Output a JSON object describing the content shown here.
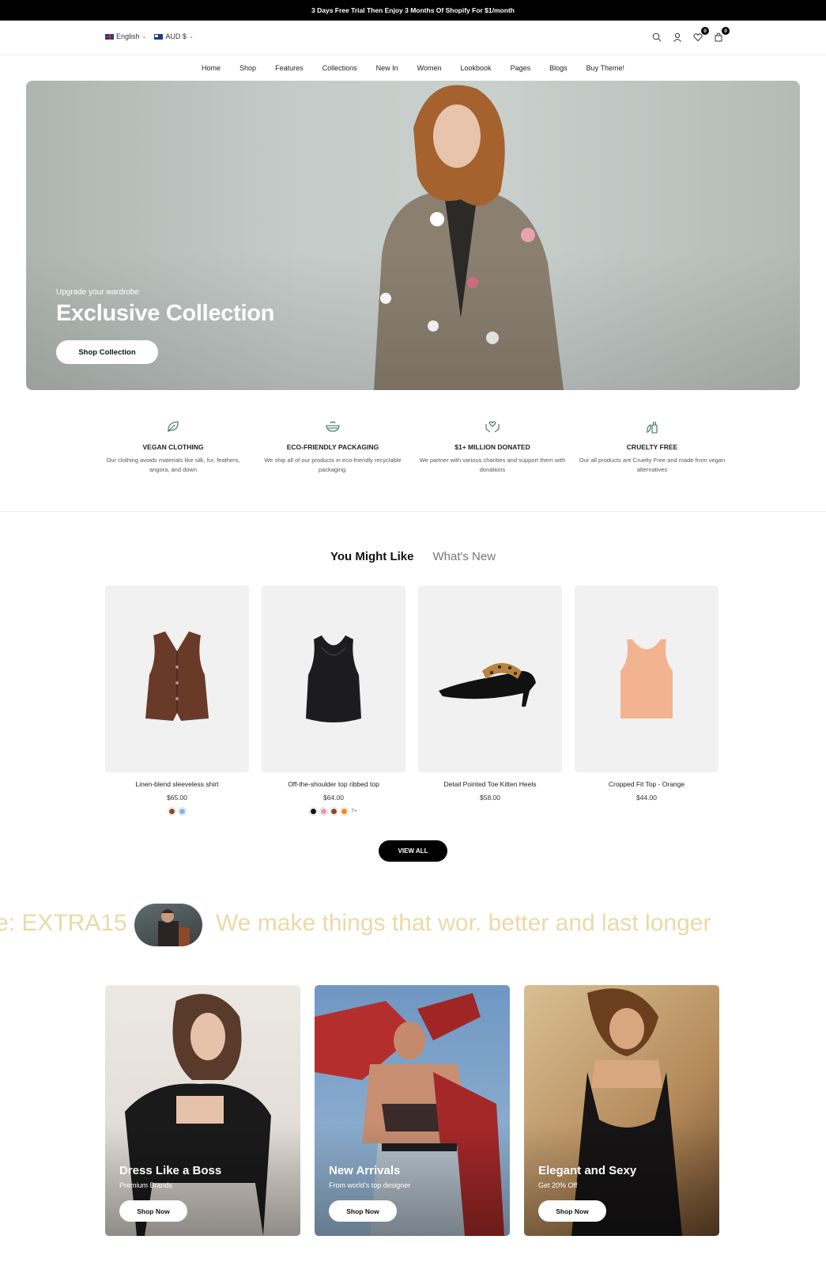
{
  "announcement": "3 Days Free Trial Then Enjoy 3 Months Of Shopify For $1/month",
  "header": {
    "language": "English",
    "currency": "AUD $",
    "wishlist_count": "0",
    "cart_count": "0"
  },
  "nav": [
    "Home",
    "Shop",
    "Features",
    "Collections",
    "New In",
    "Women",
    "Lookbook",
    "Pages",
    "Blogs",
    "Buy Theme!"
  ],
  "hero": {
    "subtitle": "Upgrade your wardrobe",
    "title": "Exclusive Collection",
    "button": "Shop Collection"
  },
  "features": [
    {
      "icon": "leaf-icon",
      "title": "VEGAN CLOTHING",
      "desc": "Our clothing avoids materials like silk, fur, feathers, angora, and down"
    },
    {
      "icon": "bowl-icon",
      "title": "ECO-FRIENDLY PACKAGING",
      "desc": "We ship all of our products in eco-friendly recyclable packaging."
    },
    {
      "icon": "hands-heart-icon",
      "title": "$1+ MILLION DONATED",
      "desc": "We partner with various charities and support them with donations"
    },
    {
      "icon": "bottle-icon",
      "title": "CRUELTY FREE",
      "desc": "Our all products are Cruelty Free and made from vegan alternatives"
    }
  ],
  "tabs": {
    "active": "You Might Like",
    "inactive": "What's New"
  },
  "products": [
    {
      "name": "Linen-blend sleeveless shirt",
      "price": "$65.00",
      "swatches": [
        "#8b4a2b",
        "#7fb6ef"
      ],
      "more": ""
    },
    {
      "name": "Off-the-shoulder top ribbed top",
      "price": "$64.00",
      "swatches": [
        "#111111",
        "#e79aa9",
        "#8b4a2b",
        "#f08a1c"
      ],
      "more": "7+"
    },
    {
      "name": "Detail Pointed Toe Kitten Heels",
      "price": "$58.00",
      "swatches": [],
      "more": ""
    },
    {
      "name": "Cropped Fit Top - Orange",
      "price": "$44.00",
      "swatches": [],
      "more": ""
    }
  ],
  "view_all": "VIEW ALL",
  "marquee": {
    "left": "e: EXTRA15",
    "right": "We make things that wor. better and last longer"
  },
  "cards": [
    {
      "title": "Dress Like a Boss",
      "subtitle": "Premium Brands",
      "button": "Shop Now"
    },
    {
      "title": "New Arrivals",
      "subtitle": "From world's top designer",
      "button": "Shop Now"
    },
    {
      "title": "Elegant and Sexy",
      "subtitle": "Get 20% Off",
      "button": "Shop Now"
    }
  ],
  "colors": {
    "accent": "#000000",
    "marquee_text": "#ead9a8"
  }
}
